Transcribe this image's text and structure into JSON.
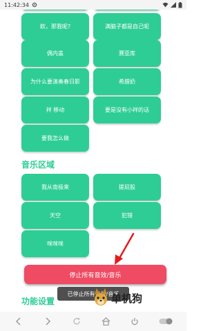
{
  "status_bar": {
    "time": "11:42:34"
  },
  "sound_buttons": [
    {
      "label": "欸，那我呢?"
    },
    {
      "label": "满脑子都是自己呢"
    },
    {
      "label": "偶内盖"
    },
    {
      "label": "赛亚库"
    },
    {
      "label": "为什么要演奏春日影"
    },
    {
      "label": "希腊奶"
    },
    {
      "label": "祥 移动"
    },
    {
      "label": "要是没有小祥的话"
    },
    {
      "label": "要我怎么做"
    }
  ],
  "music_section": {
    "title": "音乐区域",
    "buttons": [
      {
        "label": "我从南极来"
      },
      {
        "label": "搓屁股"
      },
      {
        "label": "天空"
      },
      {
        "label": "犯错"
      },
      {
        "label": "咪咪咪"
      }
    ]
  },
  "stop_button": {
    "label": "停止所有音效/音乐"
  },
  "toast": {
    "text": "已停止所有音效/音乐"
  },
  "settings_section": {
    "title": "功能设置"
  },
  "watermark": {
    "text": "单机狗"
  },
  "colors": {
    "accent_green": "#2ecd95",
    "stop_red": "#ef4b63",
    "arrow_red": "#e31b1b"
  }
}
